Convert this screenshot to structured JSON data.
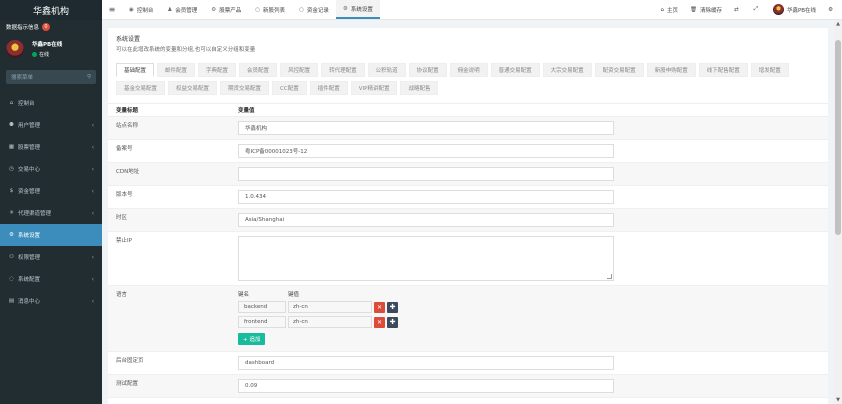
{
  "sidebar": {
    "brand": "华鑫机构",
    "notice_label": "数据指示信息",
    "notice_count": "0",
    "user_name": "华鑫PB在线",
    "user_status": "在线",
    "search_placeholder": "搜索菜单",
    "items": [
      {
        "icon": "⌂",
        "label": "控制台",
        "chev": ""
      },
      {
        "icon": "⚉",
        "label": "用户管理",
        "chev": "‹"
      },
      {
        "icon": "▦",
        "label": "股票管理",
        "chev": "‹"
      },
      {
        "icon": "◷",
        "label": "交易中心",
        "chev": "‹"
      },
      {
        "icon": "$",
        "label": "资金管理",
        "chev": "‹"
      },
      {
        "icon": "✳",
        "label": "代理渠道管理",
        "chev": "‹"
      },
      {
        "icon": "⚙",
        "label": "系统设置",
        "chev": ""
      },
      {
        "icon": "⚇",
        "label": "权限管理",
        "chev": "‹"
      },
      {
        "icon": "◌",
        "label": "系统配置",
        "chev": "‹"
      },
      {
        "icon": "▤",
        "label": "消息中心",
        "chev": "‹"
      }
    ]
  },
  "topbar": {
    "nav": [
      {
        "icon": "◉",
        "label": "控制台"
      },
      {
        "icon": "♟",
        "label": "会员管理"
      },
      {
        "icon": "⚙",
        "label": "股票产品"
      },
      {
        "icon": "○",
        "label": "新股列表"
      },
      {
        "icon": "○",
        "label": "资金记录"
      },
      {
        "icon": "⚙",
        "label": "系统设置"
      }
    ],
    "right": [
      {
        "icon": "⌂",
        "label": "主页"
      },
      {
        "icon": "🗑",
        "label": "清除缓存"
      },
      {
        "icon": "⇄",
        "label": ""
      },
      {
        "icon": "⤢",
        "label": ""
      },
      {
        "icon": "",
        "label": "华鑫PB在线"
      },
      {
        "icon": "⚙",
        "label": ""
      }
    ]
  },
  "panel": {
    "title": "系统设置",
    "subtitle": "可以在此增改系统的变量和分组,也可以自定义分组和变量",
    "tabs": [
      "基础配置",
      "邮件配置",
      "字典配置",
      "会员配置",
      "风控配置",
      "转代理配置",
      "公积轨道",
      "协议配置",
      "佣金说明",
      "普通交易配置",
      "大宗交易配置",
      "配资交易配置",
      "新股申购配置",
      "线下配售配置",
      "增发配置",
      "基金交易配置",
      "权益交易配置",
      "期货交易配置",
      "CC配置",
      "插件配置",
      "VIP精讲配置",
      "战略配售"
    ],
    "col_var": "变量标题",
    "col_val": "变量值",
    "rows": {
      "site_name": {
        "label": "站点名称",
        "value": "华鑫机构"
      },
      "beian": {
        "label": "备案号",
        "value": "粤ICP备00001023号-12"
      },
      "cdn": {
        "label": "CDN地址",
        "value": ""
      },
      "version": {
        "label": "版本号",
        "value": "1.0.434"
      },
      "timezone": {
        "label": "时区",
        "value": "Asia/Shanghai"
      },
      "forbidden": {
        "label": "禁止IP",
        "value": ""
      },
      "lang": {
        "label": "语言",
        "key_head": "键名",
        "val_head": "键值",
        "items": [
          {
            "key": "backend",
            "val": "zh-cn"
          },
          {
            "key": "frontend",
            "val": "zh-cn"
          }
        ],
        "add_label": "+ 追加"
      },
      "admin_home": {
        "label": "后台固定页",
        "value": "dashboard"
      },
      "test": {
        "label": "测试配置",
        "value": "0.09"
      }
    }
  }
}
